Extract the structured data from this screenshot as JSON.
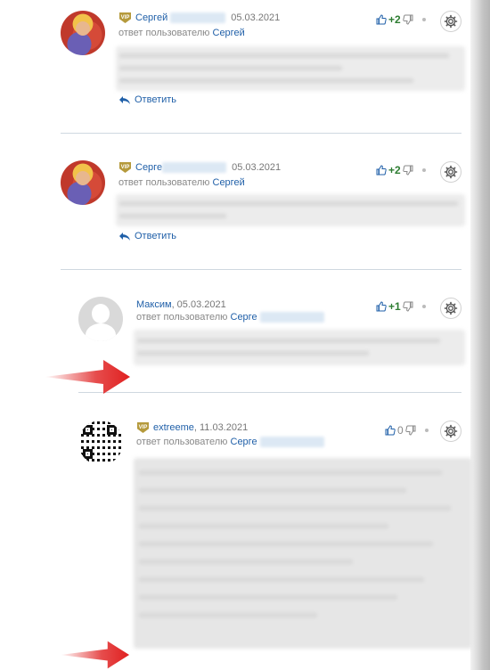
{
  "comments": [
    {
      "author": "Сергей",
      "date": "05.03.2021",
      "reply_prefix": "ответ пользователю",
      "reply_to": "Сергей",
      "rating": "+2",
      "reply_label": "Ответить",
      "vip": "VIP"
    },
    {
      "author": "Серге",
      "date": "05.03.2021",
      "reply_prefix": "ответ пользователю",
      "reply_to": "Сергей",
      "rating": "+2",
      "reply_label": "Ответить",
      "vip": "VIP"
    },
    {
      "author": "Максим",
      "date": ", 05.03.2021",
      "reply_prefix": "ответ пользователю",
      "reply_to": "Серге",
      "rating": "+1"
    },
    {
      "author": "extreeme",
      "date": ", 11.03.2021",
      "reply_prefix": "ответ пользователю",
      "reply_to": "Серге",
      "rating": "0",
      "vip": "VIP"
    }
  ],
  "colors": {
    "link": "#1f5fa8",
    "positive": "#2e7d32",
    "vip": "#b59a3c",
    "arrow": "#e02020"
  },
  "icons": [
    "vip-badge-icon",
    "thumbs-up-icon",
    "thumbs-down-icon",
    "gear-icon",
    "reply-arrow-icon",
    "red-arrow-icon"
  ]
}
